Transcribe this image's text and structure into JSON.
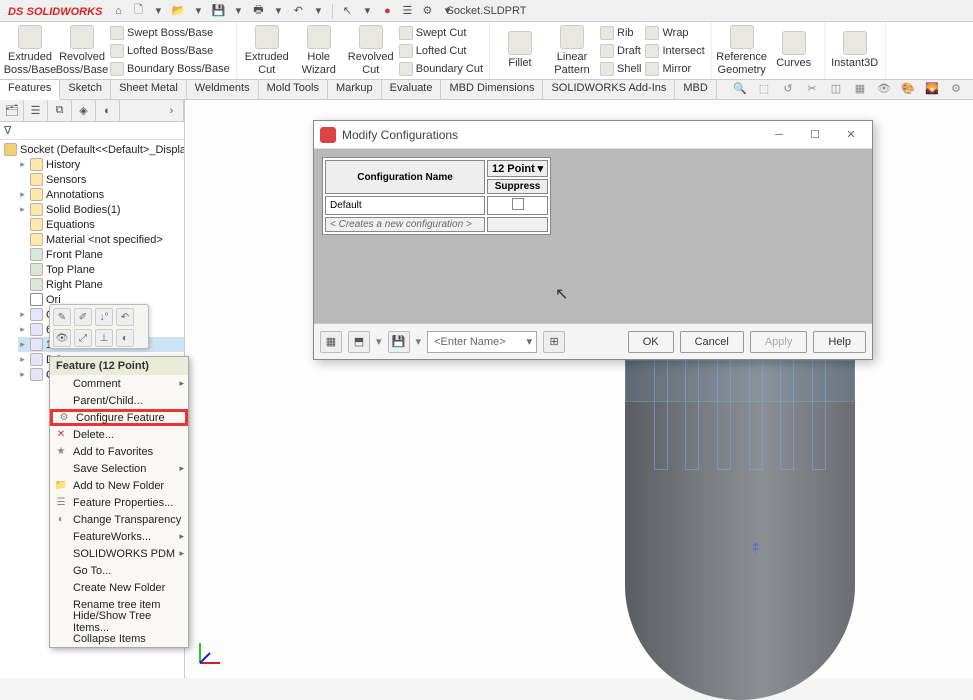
{
  "app": {
    "name": "SOLIDWORKS",
    "doc_title": "Socket.SLDPRT"
  },
  "ribbon": {
    "big": {
      "extruded": "Extruded Boss/Base",
      "revolved": "Revolved Boss/Base",
      "extruded_cut": "Extruded Cut",
      "hole_wizard": "Hole Wizard",
      "revolved_cut": "Revolved Cut",
      "fillet": "Fillet",
      "linear_pattern": "Linear Pattern",
      "ref_geom": "Reference Geometry",
      "curves": "Curves",
      "instant3d": "Instant3D"
    },
    "small": {
      "swept": "Swept Boss/Base",
      "lofted": "Lofted Boss/Base",
      "boundary": "Boundary Boss/Base",
      "swept_cut": "Swept Cut",
      "lofted_cut": "Lofted Cut",
      "boundary_cut": "Boundary Cut",
      "rib": "Rib",
      "draft": "Draft",
      "shell": "Shell",
      "wrap": "Wrap",
      "intersect": "Intersect",
      "mirror": "Mirror"
    }
  },
  "tabs": [
    "Features",
    "Sketch",
    "Sheet Metal",
    "Weldments",
    "Mold Tools",
    "Markup",
    "Evaluate",
    "MBD Dimensions",
    "SOLIDWORKS Add-Ins",
    "MBD"
  ],
  "fm": {
    "root": "Socket (Default<<Default>_Display Stat",
    "nodes": {
      "history": "History",
      "sensors": "Sensors",
      "annotations": "Annotations",
      "solid_bodies": "Solid Bodies(1)",
      "equations": "Equations",
      "material": "Material <not specified>",
      "front": "Front Plane",
      "top": "Top Plane",
      "right": "Right Plane",
      "origin": "Ori",
      "cyl": "Cyl",
      "six": "6 P",
      "twelve": "12 P",
      "drive": "Dri",
      "chamfer": "Cha"
    }
  },
  "ctx_header": "Feature (12 Point)",
  "ctx_items": {
    "comment": "Comment",
    "parent_child": "Parent/Child...",
    "configure": "Configure Feature",
    "delete": "Delete...",
    "add_fav": "Add to Favorites",
    "save_sel": "Save Selection",
    "add_folder": "Add to New Folder",
    "feat_props": "Feature Properties...",
    "transparency": "Change Transparency",
    "featureworks": "FeatureWorks...",
    "pdm": "SOLIDWORKS PDM",
    "goto": "Go To...",
    "create_folder": "Create New Folder",
    "rename": "Rename tree item",
    "hide_show": "Hide/Show Tree Items...",
    "collapse": "Collapse Items"
  },
  "dialog": {
    "title": "Modify Configurations",
    "col_config": "Configuration Name",
    "col_feature": "12 Point",
    "col_suppress": "Suppress",
    "row_default": "Default",
    "row_new": "< Creates a new configuration >",
    "enter_name": "<Enter Name>",
    "ok": "OK",
    "cancel": "Cancel",
    "apply": "Apply",
    "help": "Help"
  }
}
